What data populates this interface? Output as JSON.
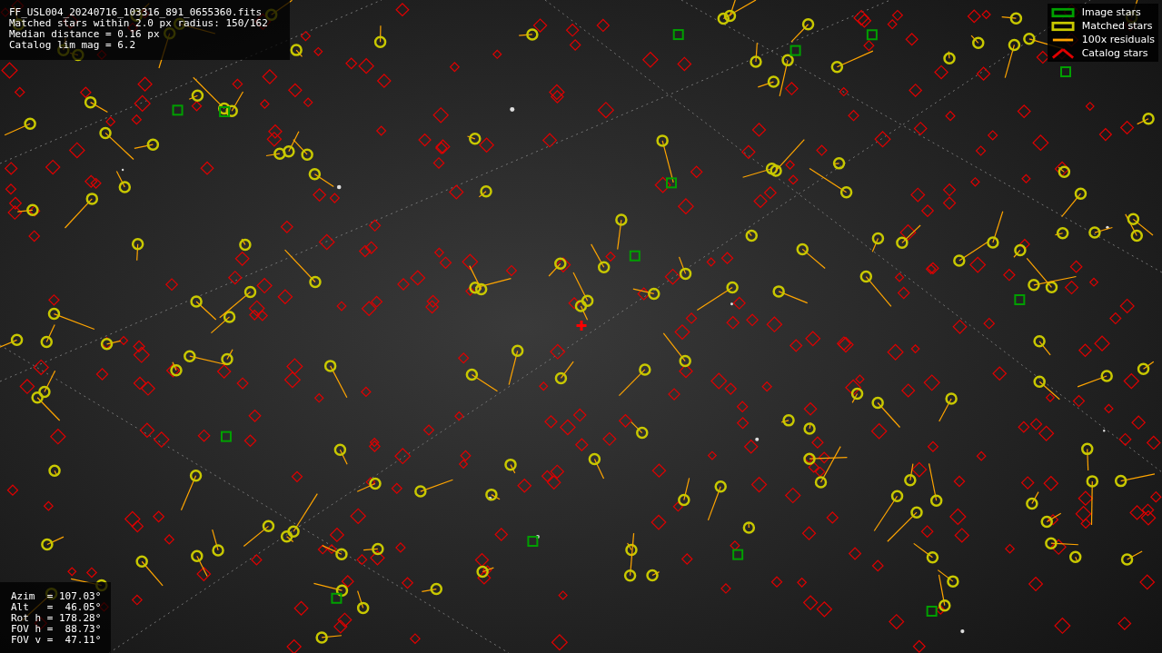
{
  "info": {
    "lines": [
      "FF_USL004_20240716_103316_891_0655360.fits",
      "Matched stars within 2.0 px radius: 150/162",
      "Median distance = 0.16 px",
      "Catalog lim mag = 6.2"
    ]
  },
  "legend": [
    {
      "kind": "image",
      "label": "Image stars",
      "color": "#00a000"
    },
    {
      "kind": "matched",
      "label": "Matched stars",
      "color": "#c8c800"
    },
    {
      "kind": "residual",
      "label": "100x residuals",
      "color": "#ffa500"
    },
    {
      "kind": "catalog",
      "label": "Catalog stars",
      "color": "#e00000"
    }
  ],
  "pointing": {
    "lines": [
      "Azim  = 107.03°",
      "Alt   =  46.05°",
      "Rot h = 178.28°",
      "FOV h =  88.73°",
      "FOV v =  47.11°"
    ]
  }
}
